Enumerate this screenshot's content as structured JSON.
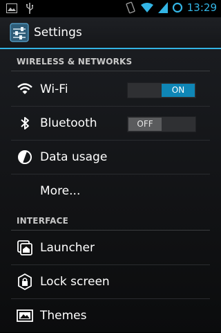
{
  "status_bar": {
    "left_icons": [
      "image-notification-icon",
      "usb-icon"
    ],
    "right_icons": [
      "vibrate-icon",
      "wifi-icon",
      "cell-signal-icon",
      "sync-circle-icon"
    ],
    "time": "13:29"
  },
  "action_bar": {
    "title": "Settings",
    "icon": "settings-sliders-icon"
  },
  "sections": {
    "wireless": {
      "header": "WIRELESS & NETWORKS",
      "wifi": {
        "label": "Wi-Fi",
        "icon": "wifi-icon",
        "switch": "ON"
      },
      "bluetooth": {
        "label": "Bluetooth",
        "icon": "bluetooth-icon",
        "switch": "OFF"
      },
      "data_usage": {
        "label": "Data usage",
        "icon": "data-usage-icon"
      },
      "more": {
        "label": "More..."
      }
    },
    "interface": {
      "header": "INTERFACE",
      "launcher": {
        "label": "Launcher",
        "icon": "launcher-icon"
      },
      "lock_screen": {
        "label": "Lock screen",
        "icon": "lock-screen-icon"
      },
      "themes": {
        "label": "Themes",
        "icon": "themes-icon"
      }
    }
  },
  "colors": {
    "accent": "#33b5e5",
    "switch_on": "#0f86b6",
    "switch_off_thumb": "#5a5b5d"
  }
}
